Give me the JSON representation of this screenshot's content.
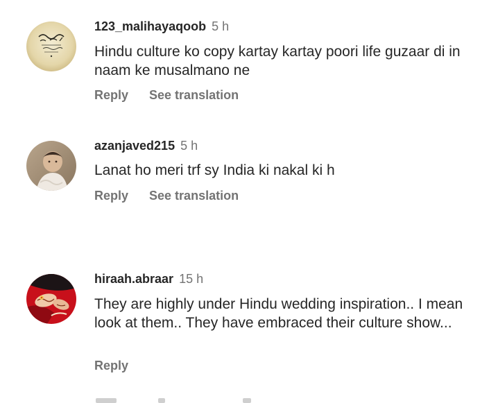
{
  "comments": [
    {
      "username": "123_malihayaqoob",
      "time": "5 h",
      "text": "Hindu culture ko copy kartay kartay poori life guzaar di in naam ke musalmano ne",
      "reply_label": "Reply",
      "translate_label": "See translation",
      "avatar_icon": "calligraphy-avatar-icon"
    },
    {
      "username": "azanjaved215",
      "time": "5 h",
      "text": "Lanat ho meri trf sy India ki nakal ki h",
      "reply_label": "Reply",
      "translate_label": "See translation",
      "avatar_icon": "child-photo-avatar-icon"
    },
    {
      "username": "hiraah.abraar",
      "time": "15 h",
      "text": "They are highly under Hindu wedding inspiration.. I mean look at them.. They have embraced their culture show...",
      "reply_label": "Reply",
      "avatar_icon": "henna-hands-avatar-icon"
    }
  ],
  "colors": {
    "text_primary": "#262626",
    "text_secondary": "#737373",
    "background": "#ffffff"
  }
}
